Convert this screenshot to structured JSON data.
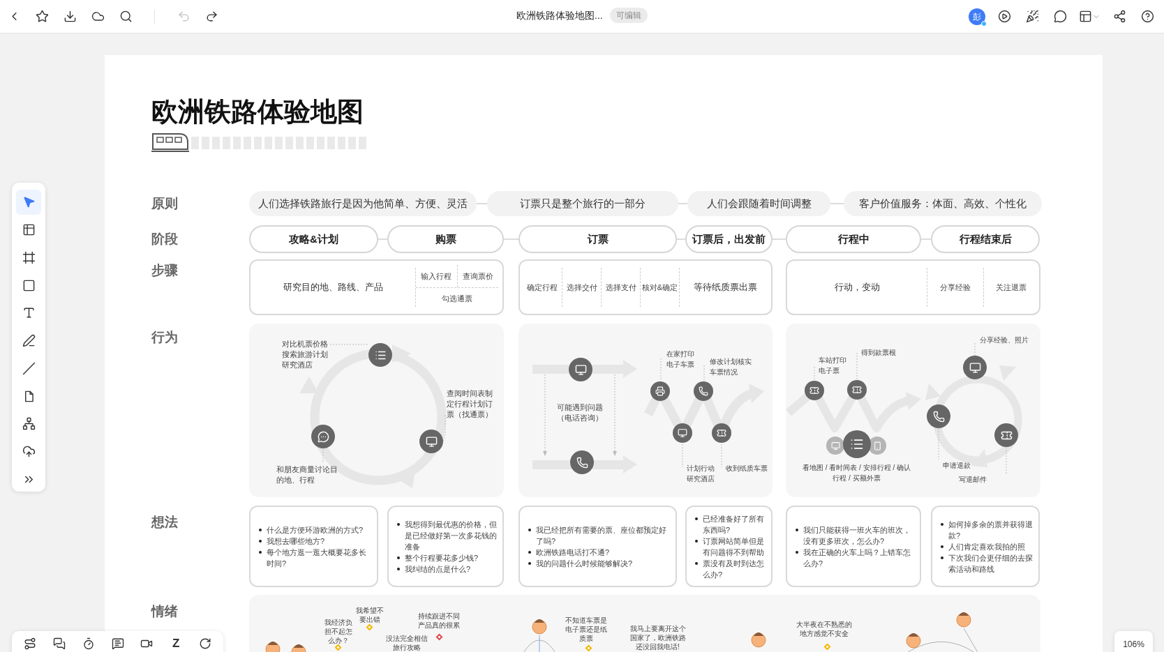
{
  "top_bar": {
    "doc_title": "欧洲铁路体验地图...",
    "badge": "可编辑",
    "avatar": "彭",
    "undo_disabled": true
  },
  "tools": [
    {
      "kind": "pointer",
      "selected": true
    },
    {
      "kind": "table",
      "selected": false
    },
    {
      "kind": "frame",
      "selected": false
    },
    {
      "kind": "shape",
      "selected": false
    },
    {
      "kind": "text",
      "selected": false
    },
    {
      "kind": "pen",
      "selected": false
    },
    {
      "kind": "line",
      "selected": false
    },
    {
      "kind": "note",
      "selected": false
    },
    {
      "kind": "mindmap",
      "selected": false
    },
    {
      "kind": "upload",
      "selected": false
    },
    {
      "kind": "more",
      "selected": false
    }
  ],
  "bottom_tools": [
    {
      "kind": "flow"
    },
    {
      "kind": "comments"
    },
    {
      "kind": "timer"
    },
    {
      "kind": "chat"
    },
    {
      "kind": "video"
    },
    {
      "kind": "letter",
      "text": "Z"
    },
    {
      "kind": "history"
    }
  ],
  "zoom": "106%",
  "board": {
    "title": "欧洲铁路体验地图",
    "principles": {
      "label": "原则",
      "items": [
        "人们选择铁路旅行是因为他简单、方便、灵活",
        "订票只是整个旅行的一部分",
        "人们会跟随着时间调整",
        "客户价值服务：体面、高效、个性化"
      ]
    },
    "stages": {
      "label": "阶段",
      "items": [
        "攻略&计划",
        "购票",
        "订票",
        "订票后，出发前",
        "行程中",
        "行程结束后"
      ]
    },
    "steps": {
      "label": "步骤",
      "groups": [
        {
          "kind": "main_split",
          "main": "研究目的地、路线、产品",
          "top": [
            "输入行程",
            "查询票价"
          ],
          "bottom": "勾选通票"
        },
        {
          "kind": "cells_main",
          "cells": [
            "确定行程",
            "选择交付",
            "选择支付",
            "核对&确定"
          ],
          "main": "等待纸质票出票"
        },
        {
          "kind": "main_cells",
          "main": "行动，变动",
          "cells": [
            "分享经验",
            "关注退票"
          ]
        }
      ]
    },
    "behaviors": {
      "label": "行为",
      "panels": [
        {
          "notes": [
            "对比机票价格搜索旅游计划研究酒店",
            "查阅时间表制定行程计划订票（找通票）",
            "和朋友商量讨论目的地、行程"
          ]
        },
        {
          "notes": [
            "可能遇到问题（电话咨询）",
            "在家打印电子车票",
            "修改计划核实车票情况",
            "计划行动研究酒店",
            "收到纸质车票"
          ]
        },
        {
          "notes": [
            "车站打印电子票",
            "得到款票根",
            "看地图 / 看时间表 / 安排行程 / 确认行程 / 买额外票",
            "分享经验、照片",
            "申请退款",
            "写退邮件"
          ]
        }
      ]
    },
    "thoughts": {
      "label": "想法",
      "cards": [
        {
          "items": [
            "什么是方便环游欧洲的方式?",
            "我想去哪些地方?",
            "每个地方逛一逛大概要花多长时间?"
          ]
        },
        {
          "items": [
            "我想得到最优惠的价格，但是已经做好第一次多花钱的准备",
            "整个行程要花多少钱?",
            "我纠结的点是什么?"
          ]
        },
        {
          "items": [
            "我已经把所有需要的票、座位都预定好了吗?",
            "欧洲铁路电话打不通?",
            "我的问题什么时候能够解决?"
          ]
        },
        {
          "items": [
            "已经准备好了所有东西吗?",
            "订票网站简单但是有问题得不到帮助",
            "票没有及时到达怎么办?"
          ]
        },
        {
          "items": [
            "我们只能获得一班火车的班次，没有更多班次，怎么办?",
            "我在正确的火车上吗？上错车怎么办?"
          ]
        },
        {
          "items": [
            "如何掉多余的票并获得退款?",
            "人们肯定喜欢我拍的照",
            "下次我们会更仔细的去探索活动和路线"
          ]
        }
      ]
    },
    "emotions": {
      "label": "情绪",
      "notes": [
        {
          "text": "我经济负担不起怎么办？",
          "color": "#f2b700"
        },
        {
          "text": "我希望不要出错",
          "color": "#f2b700"
        },
        {
          "text": "没法完全相信旅行攻略"
        },
        {
          "text": "持续跟进不同产品真的很累",
          "color": "#e0474c"
        },
        {
          "text": "不知道车票是电子票还是纸质票",
          "color": "#f2b700"
        },
        {
          "text": "我马上要离开这个国家了，欧洲铁路还没回我电话!"
        },
        {
          "text": "大半夜在不熟悉的地方感觉不安全",
          "color": "#f2b700"
        }
      ]
    }
  }
}
